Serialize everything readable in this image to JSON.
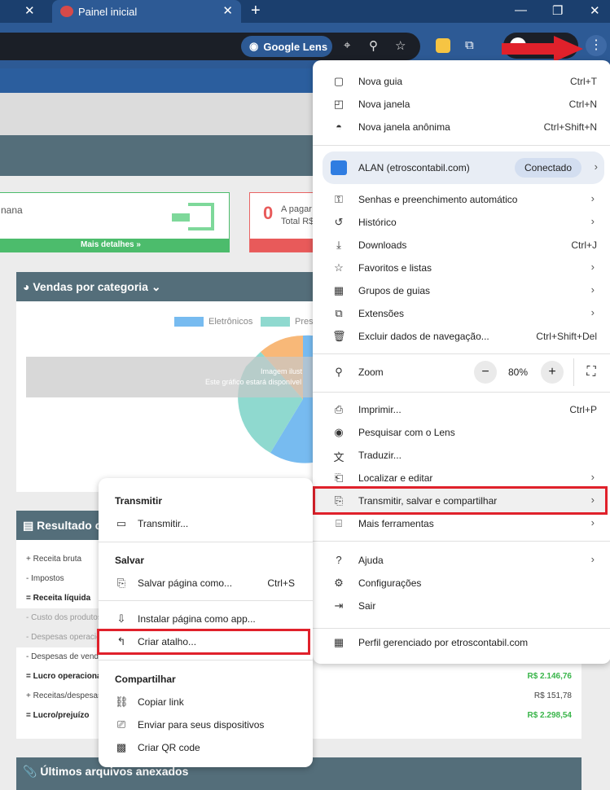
{
  "browser": {
    "tab_title": "Painel inicial",
    "lens_chip_label": "Google Lens"
  },
  "page": {
    "card_green": {
      "partial_text": "nana",
      "footer": "Mais detalhes »"
    },
    "card_red": {
      "number": "0",
      "line1": "A pagar",
      "line2": "Total R$"
    },
    "vendas": {
      "title": "Vendas por categoria",
      "legend": [
        "Eletrônicos",
        "Pres"
      ],
      "overlay_title": "Imagem ilust",
      "overlay_text": "Este gráfico estará disponível"
    },
    "resultado": {
      "title": "Resultado co",
      "rows": [
        {
          "label": "+ Receita bruta",
          "value": "",
          "style": "normal"
        },
        {
          "label": "- Impostos",
          "value": "",
          "style": "normal"
        },
        {
          "label": "= Receita líquida",
          "value": "",
          "style": "bold"
        },
        {
          "label": "- Custo dos produtos",
          "value": "",
          "style": "shade"
        },
        {
          "label": "- Despesas operacio",
          "value": "",
          "style": "shade"
        },
        {
          "label": "- Despesas de venda",
          "value": "",
          "style": "normal"
        },
        {
          "label": "= Lucro operaciona",
          "value": "R$ 2.146,76",
          "style": "bold-green"
        },
        {
          "label": "+ Receitas/despesas",
          "value": "R$ 151,78",
          "style": "normal"
        },
        {
          "label": "= Lucro/prejuízo",
          "value": "R$ 2.298,54",
          "style": "bold-green"
        }
      ]
    },
    "arquivos_title": "Últimos arquivos anexados"
  },
  "chrome_menu": {
    "group1": [
      {
        "icon": "new-tab-icon",
        "label": "Nova guia",
        "shortcut": "Ctrl+T"
      },
      {
        "icon": "new-window-icon",
        "label": "Nova janela",
        "shortcut": "Ctrl+N"
      },
      {
        "icon": "incognito-icon",
        "label": "Nova janela anônima",
        "shortcut": "Ctrl+Shift+N"
      }
    ],
    "profile": {
      "name": "ALAN (etroscontabil.com)",
      "status": "Conectado"
    },
    "group2": [
      {
        "icon": "key-icon",
        "label": "Senhas e preenchimento automático",
        "shortcut": ""
      },
      {
        "icon": "history-icon",
        "label": "Histórico",
        "shortcut": ""
      },
      {
        "icon": "download-icon",
        "label": "Downloads",
        "shortcut": "Ctrl+J"
      },
      {
        "icon": "star-icon",
        "label": "Favoritos e listas",
        "shortcut": ""
      },
      {
        "icon": "grid-icon",
        "label": "Grupos de guias",
        "shortcut": ""
      },
      {
        "icon": "puzzle-icon",
        "label": "Extensões",
        "shortcut": ""
      },
      {
        "icon": "trash-icon",
        "label": "Excluir dados de navegação...",
        "shortcut": "Ctrl+Shift+Del"
      }
    ],
    "zoom": {
      "label": "Zoom",
      "minus": "−",
      "value": "80%",
      "plus": "+"
    },
    "group3": [
      {
        "icon": "print-icon",
        "label": "Imprimir...",
        "shortcut": "Ctrl+P"
      },
      {
        "icon": "lens-icon",
        "label": "Pesquisar com o Lens",
        "shortcut": ""
      },
      {
        "icon": "translate-icon",
        "label": "Traduzir...",
        "shortcut": ""
      },
      {
        "icon": "find-icon",
        "label": "Localizar e editar",
        "shortcut": ""
      },
      {
        "icon": "save-share-icon",
        "label": "Transmitir, salvar e compartilhar",
        "shortcut": ""
      },
      {
        "icon": "toolbox-icon",
        "label": "Mais ferramentas",
        "shortcut": ""
      }
    ],
    "group4": [
      {
        "icon": "help-icon",
        "label": "Ajuda",
        "shortcut": ""
      },
      {
        "icon": "settings-icon",
        "label": "Configurações",
        "shortcut": ""
      },
      {
        "icon": "exit-icon",
        "label": "Sair",
        "shortcut": ""
      }
    ],
    "managed": "Perfil gerenciado por etroscontabil.com"
  },
  "submenu": {
    "transmitir_header": "Transmitir",
    "transmitir_item": "Transmitir...",
    "salvar_header": "Salvar",
    "salvar_item": "Salvar página como...",
    "salvar_shortcut": "Ctrl+S",
    "instalar_item": "Instalar página como app...",
    "atalho_item": "Criar atalho...",
    "compartilhar_header": "Compartilhar",
    "copiar_link": "Copiar link",
    "enviar_dispositivos": "Enviar para seus dispositivos",
    "qr_code": "Criar QR code"
  },
  "pie_data": {
    "type": "pie",
    "colors": [
      "#77bbf0",
      "#8fd9cf",
      "#f8b878"
    ]
  }
}
